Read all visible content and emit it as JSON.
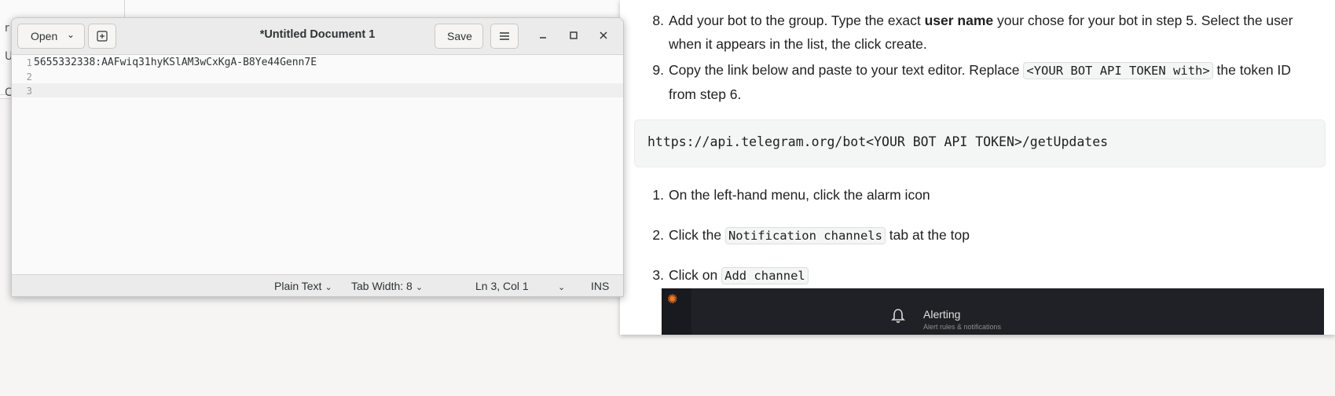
{
  "background_window": {
    "frag_1": "r",
    "frag_2": "U",
    "frag_3": "C"
  },
  "editor_window": {
    "title": "*Untitled Document 1",
    "open_label": "Open",
    "save_label": "Save",
    "lines": [
      {
        "number": "1",
        "text": "5655332338:AAFwiq31hyKSlAM3wCxKgA-B8Ye44Genn7E"
      },
      {
        "number": "2",
        "text": ""
      },
      {
        "number": "3",
        "text": ""
      }
    ],
    "status": {
      "language": "Plain Text",
      "tab_width": "Tab Width: 8",
      "position": "Ln 3, Col 1",
      "mode": "INS"
    }
  },
  "doc": {
    "step8": {
      "num": "8.",
      "pre": "Add your bot to the group. Type the exact ",
      "bold": "user name",
      "post": " your chose for your bot in step 5. Select the user",
      "line2": "when it appears in the list, the click create."
    },
    "step9": {
      "num": "9.",
      "pre": "Copy the link below and paste to your text editor. Replace ",
      "code": "<YOUR BOT API TOKEN with>",
      "post": " the token ID",
      "line2": "from step 6."
    },
    "code_block": "https://api.telegram.org/bot<YOUR BOT API TOKEN>/getUpdates",
    "step1": {
      "num": "1.",
      "text": "On the left-hand menu, click the alarm icon"
    },
    "step2": {
      "num": "2.",
      "pre": "Click the ",
      "code": "Notification channels",
      "post": " tab at the top"
    },
    "step3": {
      "num": "3.",
      "pre": "Click on ",
      "code": "Add channel"
    },
    "screenshot": {
      "title": "Alerting",
      "subtitle": "Alert rules & notifications"
    }
  }
}
